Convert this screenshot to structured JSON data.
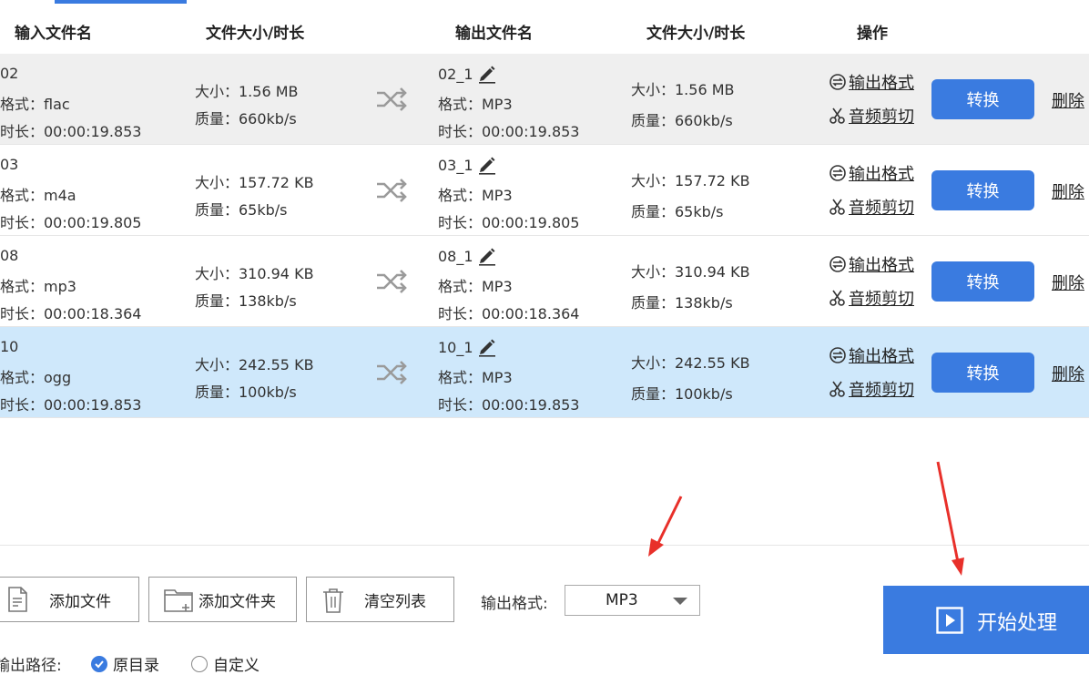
{
  "columns": {
    "input_name": "输入文件名",
    "input_size": "文件大小/时长",
    "output_name": "输出文件名",
    "output_size": "文件大小/时长",
    "ops": "操作"
  },
  "rows": [
    {
      "in_name": "02",
      "in_fmt": "格式：flac",
      "in_dur": "时长：00:00:19.853",
      "in_size": "大小：1.56 MB",
      "in_qual": "质量：660kb/s",
      "out_name": "02_1",
      "out_fmt": "格式：MP3",
      "out_dur": "时长：00:00:19.853",
      "out_size": "大小：1.56 MB",
      "out_qual": "质量：660kb/s"
    },
    {
      "in_name": "03",
      "in_fmt": "格式：m4a",
      "in_dur": "时长：00:00:19.805",
      "in_size": "大小：157.72 KB",
      "in_qual": "质量：65kb/s",
      "out_name": "03_1",
      "out_fmt": "格式：MP3",
      "out_dur": "时长：00:00:19.805",
      "out_size": "大小：157.72 KB",
      "out_qual": "质量：65kb/s"
    },
    {
      "in_name": "08",
      "in_fmt": "格式：mp3",
      "in_dur": "时长：00:00:18.364",
      "in_size": "大小：310.94 KB",
      "in_qual": "质量：138kb/s",
      "out_name": "08_1",
      "out_fmt": "格式：MP3",
      "out_dur": "时长：00:00:18.364",
      "out_size": "大小：310.94 KB",
      "out_qual": "质量：138kb/s"
    },
    {
      "in_name": "10",
      "in_fmt": "格式：ogg",
      "in_dur": "时长：00:00:19.853",
      "in_size": "大小：242.55 KB",
      "in_qual": "质量：100kb/s",
      "out_name": "10_1",
      "out_fmt": "格式：MP3",
      "out_dur": "时长：00:00:19.853",
      "out_size": "大小：242.55 KB",
      "out_qual": "质量：100kb/s"
    }
  ],
  "row_actions": {
    "output_format": "输出格式",
    "audio_cut": "音频剪切",
    "convert": "转换",
    "delete": "删除"
  },
  "toolbar": {
    "add_file": "添加文件",
    "add_folder": "添加文件夹",
    "clear_list": "清空列表",
    "format_label": "输出格式:",
    "format_value": "MP3",
    "start": "开始处理"
  },
  "output_path": {
    "label": "输出路径:",
    "option_original": "原目录",
    "option_custom": "自定义"
  },
  "colors": {
    "accent": "#3a7be0",
    "row_selected": "#cfe8fb",
    "row_grey": "#efefef",
    "annotation_arrow": "#e8302a"
  }
}
